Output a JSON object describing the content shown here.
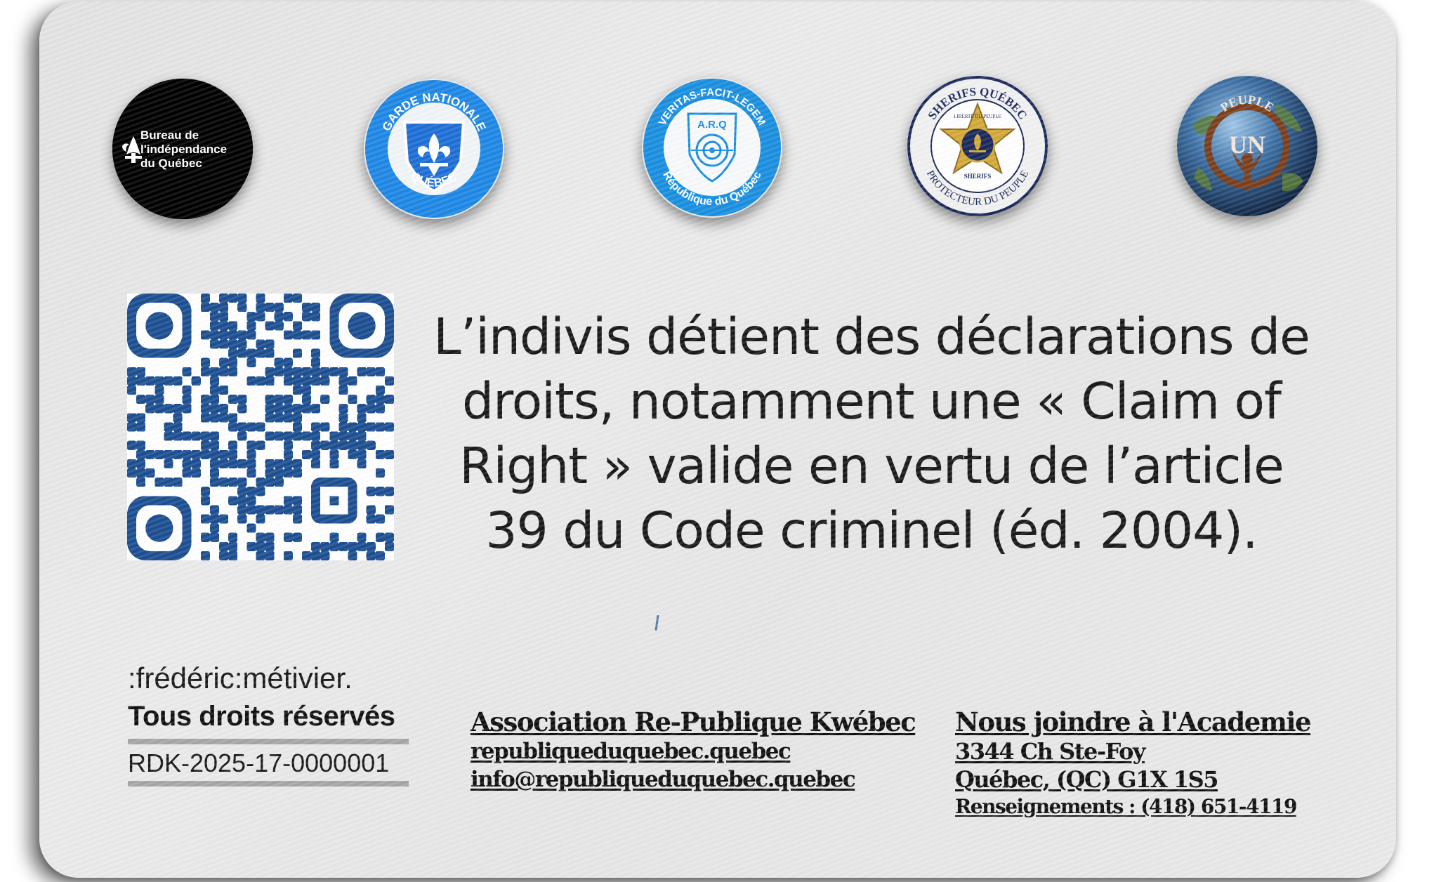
{
  "seals": {
    "bureau": {
      "line1": "Bureau de",
      "line2": "l'indépendance",
      "line3": "du Québec"
    },
    "garde": {
      "top": "GARDE NATIONALE",
      "bottom": "QUÉBEC"
    },
    "arq": {
      "top": "VERITAS-FACIT-LEGEM",
      "bottom": "République du Québec",
      "shield": "A.R.Q"
    },
    "sherifs": {
      "top": "SHERIFS QUÉBEC",
      "bottom": "PROTECTEUR DU PEUPLE",
      "ribbon_top": "LIBERTÉ DU PEUPLE",
      "ribbon_bottom": "SHERIFS"
    },
    "peuple": {
      "top": "PEUPLE",
      "middle": "UN"
    }
  },
  "declaration": "L’indivis détient des déclarations de droits, notamment une « Claim of Right » valide en vertu de l’article 39 du Code criminel (éd. 2004).",
  "signature": {
    "name": ":frédéric:métivier.",
    "rights": "Tous droits réservés",
    "reference": "RDK-2025-17-0000001"
  },
  "association": {
    "name": "Association Re-Publique Kwébec",
    "website": "republiqueduquebec.quebec",
    "email": "info@republiqueduquebec.quebec"
  },
  "contact": {
    "heading": "Nous joindre à l'Academie",
    "street": "3344 Ch Ste-Foy",
    "city": "Québec, (QC) G1X 1S5",
    "phone": "Renseignements : (418) 651-4119"
  },
  "colors": {
    "card": "#e6e6e6",
    "qr": "#1d4f91",
    "garde_blue": "#1e88e5",
    "arq_blue": "#1a8fe0",
    "sherif_navy": "#1b2a5c",
    "sherif_gold": "#d4a93a",
    "peuple_brown": "#7b3f1d"
  }
}
